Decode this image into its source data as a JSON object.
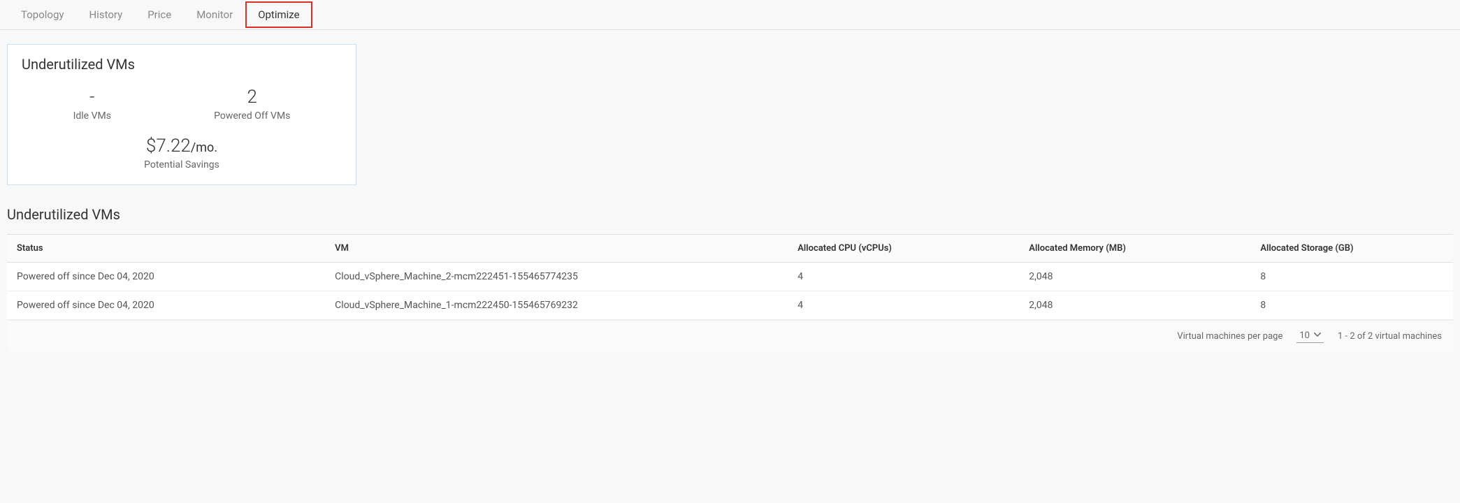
{
  "tabs": [
    {
      "label": "Topology"
    },
    {
      "label": "History"
    },
    {
      "label": "Price"
    },
    {
      "label": "Monitor"
    },
    {
      "label": "Optimize"
    }
  ],
  "card": {
    "title": "Underutilized VMs",
    "idle_value": "-",
    "idle_label": "Idle VMs",
    "powered_off_value": "2",
    "powered_off_label": "Powered Off VMs",
    "savings_value": "$7.22",
    "savings_suffix": "/mo.",
    "savings_label": "Potential Savings"
  },
  "section": {
    "title": "Underutilized VMs"
  },
  "table": {
    "headers": {
      "status": "Status",
      "vm": "VM",
      "cpu": "Allocated CPU (vCPUs)",
      "memory": "Allocated Memory (MB)",
      "storage": "Allocated Storage (GB)"
    },
    "rows": [
      {
        "status": "Powered off since Dec 04, 2020",
        "vm": "Cloud_vSphere_Machine_2-mcm222451-155465774235",
        "cpu": "4",
        "memory": "2,048",
        "storage": "8"
      },
      {
        "status": "Powered off since Dec 04, 2020",
        "vm": "Cloud_vSphere_Machine_1-mcm222450-155465769232",
        "cpu": "4",
        "memory": "2,048",
        "storage": "8"
      }
    ]
  },
  "pagination": {
    "per_page_label": "Virtual machines per page",
    "per_page_value": "10",
    "range_text": "1 - 2 of 2 virtual machines"
  }
}
